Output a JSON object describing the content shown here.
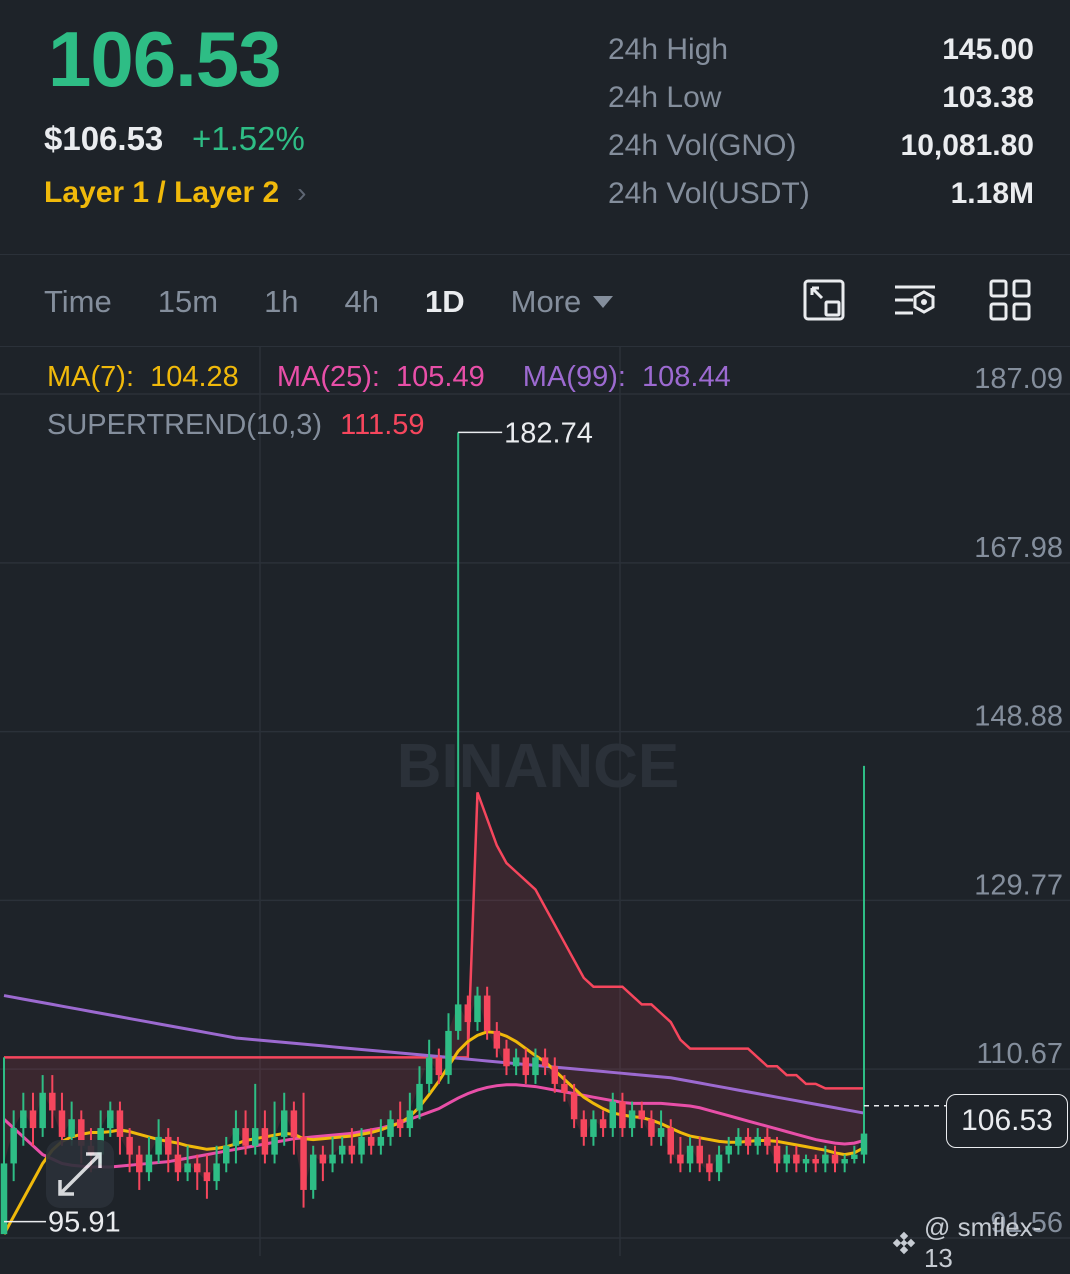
{
  "header": {
    "last_price": "106.53",
    "usd_price": "$106.53",
    "change_pct": "+1.52%",
    "category": "Layer 1 / Layer 2",
    "stats": [
      {
        "label": "24h High",
        "value": "145.00"
      },
      {
        "label": "24h Low",
        "value": "103.38"
      },
      {
        "label": "24h Vol(GNO)",
        "value": "10,081.80"
      },
      {
        "label": "24h Vol(USDT)",
        "value": "1.18M"
      }
    ]
  },
  "toolbar": {
    "timeframes": [
      "Time",
      "15m",
      "1h",
      "4h",
      "1D"
    ],
    "active_timeframe": "1D",
    "more_label": "More",
    "icons": [
      "chart-layout-icon",
      "indicator-settings-icon",
      "grid-layout-icon"
    ]
  },
  "indicators": {
    "ma7": {
      "label": "MA(7):",
      "value": "104.28",
      "color": "#f0b90b"
    },
    "ma25": {
      "label": "MA(25):",
      "value": "105.49",
      "color": "#e84fa8"
    },
    "ma99": {
      "label": "MA(99):",
      "value": "108.44",
      "color": "#9c6ad0"
    },
    "supertrend": {
      "label": "SUPERTREND(10,3)",
      "value": "111.59",
      "color": "#f6465d"
    }
  },
  "chart_data": {
    "type": "candlestick",
    "y_ticks": [
      "187.09",
      "167.98",
      "148.88",
      "129.77",
      "110.67",
      "91.56"
    ],
    "ylim": [
      91.56,
      187.09
    ],
    "max_label": "182.74",
    "min_label": "95.91",
    "last_price_label": "106.53",
    "watermark": "BINANCE",
    "colors": {
      "up": "#2ebd85",
      "down": "#f6465d",
      "grid": "#2b3139"
    },
    "candles": [
      [
        92,
        100,
        97,
        112
      ],
      [
        100,
        104,
        98,
        106
      ],
      [
        104,
        106,
        102,
        108
      ],
      [
        106,
        104,
        102,
        108
      ],
      [
        104,
        108,
        103,
        110
      ],
      [
        108,
        106,
        104,
        110
      ],
      [
        106,
        103,
        102,
        108
      ],
      [
        103,
        105,
        102,
        107
      ],
      [
        105,
        102,
        100,
        106
      ],
      [
        102,
        101,
        99,
        104
      ],
      [
        101,
        104,
        100,
        106
      ],
      [
        104,
        106,
        103,
        107
      ],
      [
        106,
        103,
        101,
        107
      ],
      [
        103,
        101,
        99,
        104
      ],
      [
        101,
        99,
        97,
        102
      ],
      [
        99,
        101,
        98,
        103
      ],
      [
        101,
        103,
        100,
        105
      ],
      [
        103,
        101,
        99,
        104
      ],
      [
        101,
        99,
        98,
        103
      ],
      [
        99,
        100,
        98,
        102
      ],
      [
        100,
        99,
        97,
        101
      ],
      [
        99,
        98,
        96,
        101
      ],
      [
        98,
        100,
        97,
        102
      ],
      [
        100,
        102,
        99,
        103
      ],
      [
        102,
        104,
        100,
        106
      ],
      [
        104,
        102,
        101,
        106
      ],
      [
        102,
        104,
        101,
        109
      ],
      [
        104,
        101,
        100,
        106
      ],
      [
        101,
        103,
        100,
        107
      ],
      [
        103,
        106,
        102,
        108
      ],
      [
        106,
        103,
        101,
        107
      ],
      [
        103,
        97,
        95,
        108
      ],
      [
        97,
        101,
        96,
        102
      ],
      [
        101,
        100,
        98,
        102
      ],
      [
        100,
        101,
        99,
        103
      ],
      [
        101,
        102,
        100,
        103
      ],
      [
        102,
        101,
        100,
        104
      ],
      [
        101,
        103,
        100,
        104
      ],
      [
        103,
        102,
        101,
        104
      ],
      [
        102,
        103,
        101,
        105
      ],
      [
        103,
        105,
        102,
        106
      ],
      [
        105,
        104,
        103,
        107
      ],
      [
        104,
        106,
        103,
        108
      ],
      [
        106,
        109,
        105,
        111
      ],
      [
        109,
        112,
        108,
        114
      ],
      [
        112,
        110,
        109,
        113
      ],
      [
        110,
        115,
        109,
        117
      ],
      [
        115,
        118,
        114,
        182.74
      ],
      [
        118,
        116,
        114,
        119
      ],
      [
        116,
        119,
        115,
        120
      ],
      [
        119,
        115,
        114,
        120
      ],
      [
        115,
        113,
        112,
        116
      ],
      [
        113,
        111,
        110,
        114
      ],
      [
        111,
        112,
        110,
        113
      ],
      [
        112,
        110,
        109,
        113
      ],
      [
        110,
        112,
        109,
        113
      ],
      [
        112,
        111,
        110,
        113
      ],
      [
        111,
        109,
        108,
        112
      ],
      [
        109,
        108,
        107,
        110
      ],
      [
        108,
        105,
        104,
        109
      ],
      [
        105,
        103,
        102,
        106
      ],
      [
        103,
        105,
        102,
        106
      ],
      [
        105,
        104,
        103,
        106
      ],
      [
        104,
        107,
        103,
        108
      ],
      [
        107,
        104,
        103,
        108
      ],
      [
        104,
        106,
        103,
        107
      ],
      [
        106,
        105,
        104,
        107
      ],
      [
        105,
        103,
        102,
        106
      ],
      [
        103,
        104,
        102,
        106
      ],
      [
        104,
        101,
        100,
        105
      ],
      [
        101,
        100,
        99,
        103
      ],
      [
        100,
        102,
        99,
        103
      ],
      [
        102,
        100,
        99,
        103
      ],
      [
        100,
        99,
        98,
        101
      ],
      [
        99,
        101,
        98,
        102
      ],
      [
        101,
        102,
        100,
        103
      ],
      [
        102,
        103,
        101,
        104
      ],
      [
        103,
        102,
        101,
        104
      ],
      [
        102,
        103,
        101,
        104
      ],
      [
        103,
        102,
        101,
        104
      ],
      [
        102,
        100,
        99,
        103
      ],
      [
        100,
        101,
        99,
        102
      ],
      [
        101,
        100,
        99,
        102
      ],
      [
        100,
        100.5,
        99,
        101
      ],
      [
        100.5,
        100,
        99,
        101
      ],
      [
        100,
        101,
        99,
        102
      ],
      [
        101,
        100,
        99,
        102
      ],
      [
        100,
        100.5,
        99,
        101
      ],
      [
        100.5,
        101,
        100,
        102
      ],
      [
        101,
        103.38,
        100,
        145
      ]
    ],
    "supertrend_line": [
      112,
      112,
      112,
      112,
      112,
      112,
      112,
      112,
      112,
      112,
      112,
      112,
      112,
      112,
      112,
      112,
      112,
      112,
      112,
      112,
      112,
      112,
      112,
      112,
      112,
      112,
      112,
      112,
      112,
      112,
      112,
      112,
      112,
      112,
      112,
      112,
      112,
      112,
      112,
      112,
      112,
      112,
      112,
      112,
      112,
      112,
      112,
      112,
      112,
      142,
      139,
      136,
      134,
      133,
      132,
      131,
      129,
      127,
      125,
      123,
      121,
      120,
      120,
      120,
      120,
      119,
      118,
      118,
      117,
      116,
      114,
      113,
      113,
      113,
      113,
      113,
      113,
      113,
      112,
      111,
      111,
      110,
      110,
      109,
      109,
      108.5,
      108.5,
      108.5,
      108.5,
      108.5
    ],
    "ma7_line": [
      92,
      94,
      96,
      98,
      100,
      101.5,
      102.5,
      103,
      103.3,
      103.5,
      103.5,
      103.6,
      103.8,
      103.6,
      103.3,
      103,
      102.7,
      102.5,
      102.3,
      102,
      101.8,
      101.6,
      101.7,
      101.9,
      102.2,
      102.6,
      102.8,
      103,
      103.2,
      103.4,
      103.3,
      102.8,
      102.7,
      102.8,
      102.9,
      103,
      103.1,
      103.3,
      103.5,
      103.8,
      104.2,
      104.6,
      105.3,
      106.4,
      107.8,
      109.3,
      111,
      112.7,
      113.8,
      114.5,
      114.9,
      114.8,
      114.4,
      113.8,
      113,
      112.2,
      111.5,
      110.5,
      109.5,
      108.5,
      107.5,
      106.8,
      106.2,
      105.7,
      105.5,
      105.3,
      105.2,
      104.9,
      104.5,
      104,
      103.5,
      103.1,
      102.9,
      102.7,
      102.5,
      102.4,
      102.4,
      102.5,
      102.6,
      102.6,
      102.5,
      102.3,
      102.1,
      101.9,
      101.7,
      101.5,
      101.2,
      101,
      101.2,
      101.8
    ],
    "ma25_line": [
      105,
      104,
      103,
      102,
      101,
      100.5,
      100,
      99.8,
      99.7,
      99.6,
      99.6,
      99.6,
      99.7,
      99.8,
      99.9,
      100,
      100.1,
      100.2,
      100.4,
      100.6,
      100.8,
      101,
      101.2,
      101.4,
      101.6,
      101.8,
      102,
      102.2,
      102.4,
      102.6,
      102.8,
      102.9,
      103,
      103.1,
      103.2,
      103.3,
      103.4,
      103.6,
      103.8,
      104,
      104.3,
      104.6,
      105,
      105.4,
      105.8,
      106.2,
      106.8,
      107.4,
      107.9,
      108.3,
      108.6,
      108.8,
      108.9,
      108.9,
      108.8,
      108.7,
      108.5,
      108.3,
      108.1,
      107.9,
      107.7,
      107.5,
      107.3,
      107.1,
      106.9,
      106.8,
      106.8,
      106.8,
      106.8,
      106.7,
      106.6,
      106.5,
      106.3,
      106,
      105.7,
      105.4,
      105.1,
      104.8,
      104.5,
      104.2,
      103.9,
      103.6,
      103.3,
      103,
      102.7,
      102.5,
      102.3,
      102.2,
      102.3,
      102.6
    ],
    "ma99_line": [
      119,
      118.8,
      118.6,
      118.4,
      118.2,
      118,
      117.8,
      117.6,
      117.4,
      117.2,
      117,
      116.8,
      116.6,
      116.4,
      116.2,
      116,
      115.8,
      115.6,
      115.4,
      115.2,
      115,
      114.8,
      114.6,
      114.4,
      114.2,
      114.1,
      114,
      113.9,
      113.8,
      113.7,
      113.6,
      113.5,
      113.4,
      113.3,
      113.2,
      113.1,
      113,
      112.9,
      112.8,
      112.7,
      112.6,
      112.5,
      112.4,
      112.3,
      112.2,
      112.1,
      112,
      111.9,
      111.8,
      111.7,
      111.6,
      111.5,
      111.4,
      111.3,
      111.2,
      111.1,
      111,
      110.9,
      110.8,
      110.7,
      110.6,
      110.5,
      110.4,
      110.3,
      110.2,
      110.1,
      110,
      109.9,
      109.8,
      109.7,
      109.5,
      109.3,
      109.1,
      108.9,
      108.7,
      108.5,
      108.3,
      108.1,
      107.9,
      107.7,
      107.5,
      107.3,
      107.1,
      106.9,
      106.7,
      106.5,
      106.3,
      106.1,
      105.9,
      105.7
    ]
  },
  "footer": {
    "watermark_user": "@ smflex-13"
  }
}
